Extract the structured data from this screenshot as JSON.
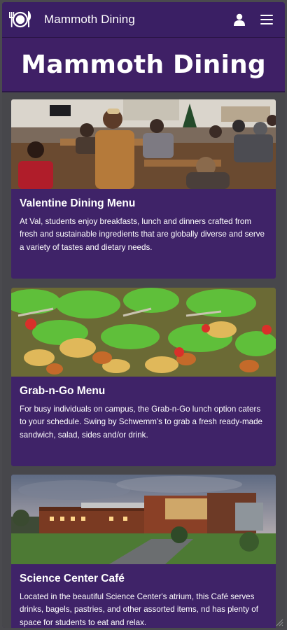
{
  "header": {
    "brand": "Mammoth Dining"
  },
  "hero": {
    "title": "Mammoth Dining"
  },
  "cards": [
    {
      "title": "Valentine Dining Menu",
      "text": "At Val, students enjoy breakfasts, lunch and dinners crafted from fresh and sustainable ingredients that are globally diverse and serve a variety of tastes and dietary needs."
    },
    {
      "title": "Grab-n-Go Menu",
      "text": "For busy individuals on campus, the Grab-n-Go lunch option caters to your schedule. Swing by Schwemm's to grab a fresh ready-made sandwich, salad, sides and/or drink."
    },
    {
      "title": "Science Center Café",
      "text": "Located in the beautiful Science Center's atrium, this Café serves drinks, bagels, pastries, and other assorted items, nd has plenty of space for students to eat and relax."
    }
  ],
  "icons": {
    "logo": "plate-fork-knife-icon",
    "account": "user-icon",
    "menu": "hamburger-menu-icon"
  },
  "colors": {
    "brand_purple": "#3f2368",
    "background_gray": "#47474b"
  }
}
